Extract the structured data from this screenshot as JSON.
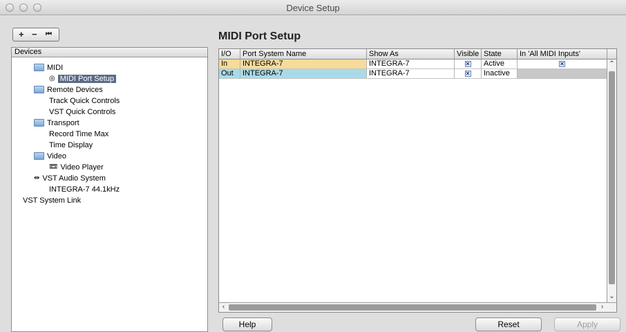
{
  "window": {
    "title": "Device Setup"
  },
  "toolbar": {
    "add_label": "+",
    "remove_label": "−",
    "reset_label": "⏮"
  },
  "devices": {
    "header": "Devices",
    "items": [
      {
        "label": "MIDI",
        "icon": "folder-icon",
        "selected": false
      },
      {
        "label": "MIDI Port Setup",
        "icon": "midi-port-icon",
        "selected": true
      },
      {
        "label": "Remote Devices",
        "icon": "folder-icon",
        "selected": false
      },
      {
        "label": "Track Quick Controls",
        "icon": "",
        "selected": false
      },
      {
        "label": "VST Quick Controls",
        "icon": "",
        "selected": false
      },
      {
        "label": "Transport",
        "icon": "folder-icon",
        "selected": false
      },
      {
        "label": "Record Time Max",
        "icon": "",
        "selected": false
      },
      {
        "label": "Time Display",
        "icon": "",
        "selected": false
      },
      {
        "label": "Video",
        "icon": "folder-icon",
        "selected": false
      },
      {
        "label": "Video Player",
        "icon": "video-player-icon",
        "selected": false
      },
      {
        "label": "VST Audio System",
        "icon": "audio-system-icon",
        "selected": false
      },
      {
        "label": "INTEGRA-7 44.1kHz",
        "icon": "",
        "selected": false
      },
      {
        "label": "VST System Link",
        "icon": "",
        "selected": false
      }
    ]
  },
  "midi_port_setup": {
    "title": "MIDI Port Setup",
    "columns": [
      "I/O",
      "Port System Name",
      "Show As",
      "Visible",
      "State",
      "In 'All MIDI Inputs'"
    ],
    "rows": [
      {
        "io": "In",
        "port": "INTEGRA-7",
        "show_as": "INTEGRA-7",
        "visible": true,
        "state": "Active",
        "all_inputs": true,
        "io_color": "#f5dc9b"
      },
      {
        "io": "Out",
        "port": "INTEGRA-7",
        "show_as": "INTEGRA-7",
        "visible": true,
        "state": "Inactive",
        "all_inputs": false,
        "io_color": "#a8dbe8"
      }
    ]
  },
  "buttons": {
    "help": "Help",
    "reset": "Reset",
    "apply": "Apply"
  },
  "colors": {
    "selection": "#5b6b86",
    "in_row": "#f5dc9b",
    "out_row": "#a8dbe8"
  }
}
